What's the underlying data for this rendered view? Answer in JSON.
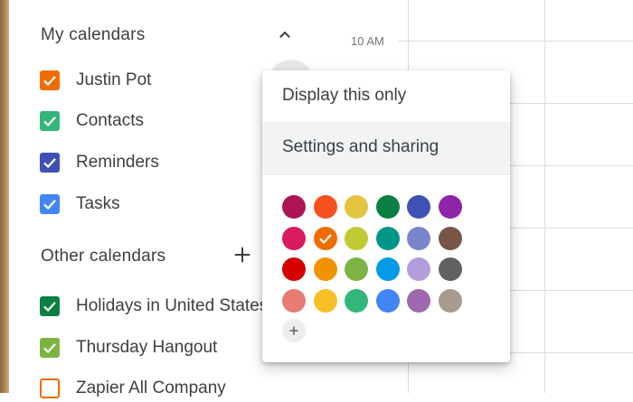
{
  "sidebar": {
    "my_calendars": {
      "title": "My calendars",
      "toggle_icon": "chevron-up-icon",
      "items": [
        {
          "label": "Justin Pot",
          "color": "#ef6c00",
          "checked": true
        },
        {
          "label": "Contacts",
          "color": "#33b679",
          "checked": true
        },
        {
          "label": "Reminders",
          "color": "#3f51b5",
          "checked": true
        },
        {
          "label": "Tasks",
          "color": "#4285f4",
          "checked": true
        }
      ]
    },
    "other_calendars": {
      "title": "Other calendars",
      "add_icon": "plus-icon",
      "items": [
        {
          "label": "Holidays in United States",
          "color": "#0b8043",
          "checked": true
        },
        {
          "label": "Thursday Hangout",
          "color": "#7cb342",
          "checked": true
        },
        {
          "label": "Zapier All Company",
          "color": "#ef6c00",
          "checked": false
        }
      ]
    }
  },
  "grid": {
    "time_label": "10 AM"
  },
  "context_menu": {
    "items": [
      {
        "label": "Display this only"
      },
      {
        "label": "Settings and sharing",
        "highlighted": true
      }
    ],
    "colors": [
      [
        "#ad1457",
        "#f4511e",
        "#e4c441",
        "#0b8043",
        "#3f51b5",
        "#8e24aa"
      ],
      [
        "#d81b60",
        "#ef6c00",
        "#c0ca33",
        "#009688",
        "#7986cb",
        "#795548"
      ],
      [
        "#d50000",
        "#f09300",
        "#7cb342",
        "#039be5",
        "#b39ddb",
        "#616161"
      ],
      [
        "#e67c73",
        "#f6bf26",
        "#33b679",
        "#4285f4",
        "#9e69af",
        "#a79b8e"
      ]
    ],
    "selected_color": "#ef6c00",
    "add_color_icon": "plus-icon"
  }
}
